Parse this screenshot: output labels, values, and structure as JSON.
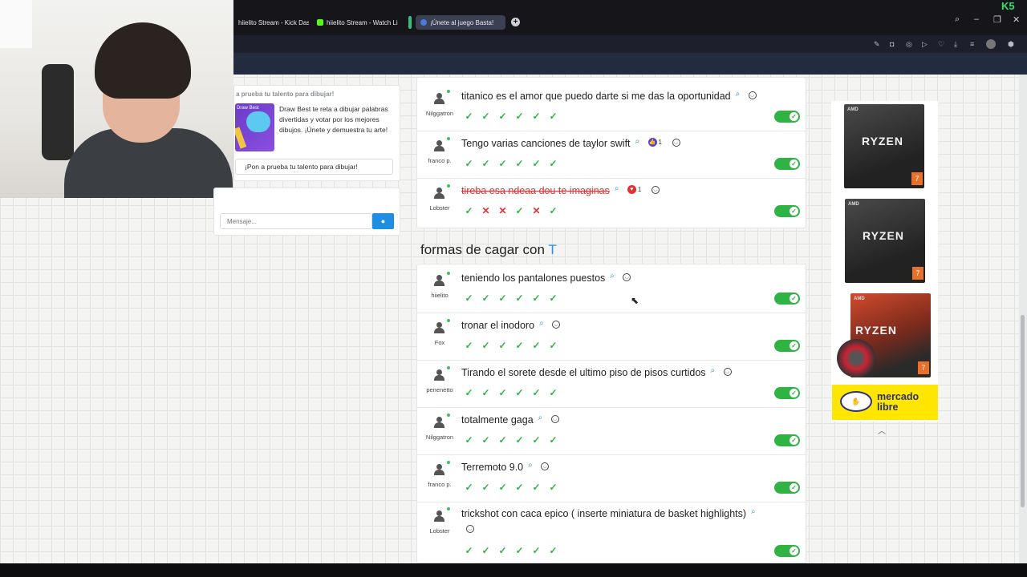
{
  "browser": {
    "tabs": [
      {
        "label": "hiielito Stream - Kick Dash",
        "color": "#53fc18"
      },
      {
        "label": "hiielito Stream - Watch Li",
        "color": "#53fc18"
      },
      {
        "label": "¡Únete al juego Basta!",
        "color": "#4a7bd8"
      }
    ],
    "corner_badge": "K5"
  },
  "chat": {
    "promo_title": "a prueba tu talento para dibujar!",
    "promo_thumb_label": "Draw Best",
    "promo_description": "Draw Best te reta a dibujar palabras divertidas y votar por los mejores dibujos. ¡Únete y demuestra tu arte!",
    "promo_button": "¡Pon a prueba tu talento para dibujar!",
    "message_placeholder": "Mensaje..."
  },
  "previous_answers": [
    {
      "user": "Nilggatron",
      "text": "titanico es el amor que puedo darte si me das la oportunidad",
      "votes": [
        "ok",
        "ok",
        "ok",
        "ok",
        "ok",
        "ok"
      ],
      "struck": false
    },
    {
      "user": "franco p.",
      "text": "Tengo varias canciones de taylor swift",
      "reaction": {
        "type": "like",
        "count": "1"
      },
      "votes": [
        "ok",
        "ok",
        "ok",
        "ok",
        "ok",
        "ok"
      ],
      "struck": false
    },
    {
      "user": "Lobster",
      "text": "tireba esa ndeaa dou te imaginas",
      "reaction": {
        "type": "heart",
        "count": "1"
      },
      "votes": [
        "ok",
        "no",
        "no",
        "ok",
        "no",
        "ok"
      ],
      "struck": true
    }
  ],
  "section": {
    "title": "formas de cagar con",
    "letter": "T"
  },
  "answers": [
    {
      "user": "hiielito",
      "text": "teniendo los pantalones puestos",
      "votes": [
        "ok",
        "ok",
        "ok",
        "ok",
        "ok",
        "ok"
      ]
    },
    {
      "user": "Fox",
      "text": "tronar el inodoro",
      "votes": [
        "ok",
        "ok",
        "ok",
        "ok",
        "ok",
        "ok"
      ]
    },
    {
      "user": "penenetto",
      "text": "Tirando el sorete desde el ultimo piso de pisos curtidos",
      "votes": [
        "ok",
        "ok",
        "ok",
        "ok",
        "ok",
        "ok"
      ]
    },
    {
      "user": "Nilggatron",
      "text": "totalmente gaga",
      "votes": [
        "ok",
        "ok",
        "ok",
        "ok",
        "ok",
        "ok"
      ]
    },
    {
      "user": "franco p.",
      "text": "Terremoto 9.0",
      "votes": [
        "ok",
        "ok",
        "ok",
        "ok",
        "ok",
        "ok"
      ]
    },
    {
      "user": "Lobster",
      "text": "trickshot con caca epico ( inserte miniatura de basket highlights)",
      "votes": [
        "ok",
        "ok",
        "ok",
        "ok",
        "ok",
        "ok"
      ]
    }
  ],
  "ad": {
    "brand": "AMD",
    "product": "RYZEN",
    "tier": "7",
    "store_line1": "mercado",
    "store_line2": "libre"
  },
  "colors": {
    "accent": "#2e8be6",
    "ok": "#2fb344",
    "reject": "#e0332f"
  },
  "icons": {
    "search": "magnifier-icon",
    "emoji": "smiley-icon",
    "toggle": "toggle-on-icon",
    "send": "chat-bubble-icon"
  }
}
